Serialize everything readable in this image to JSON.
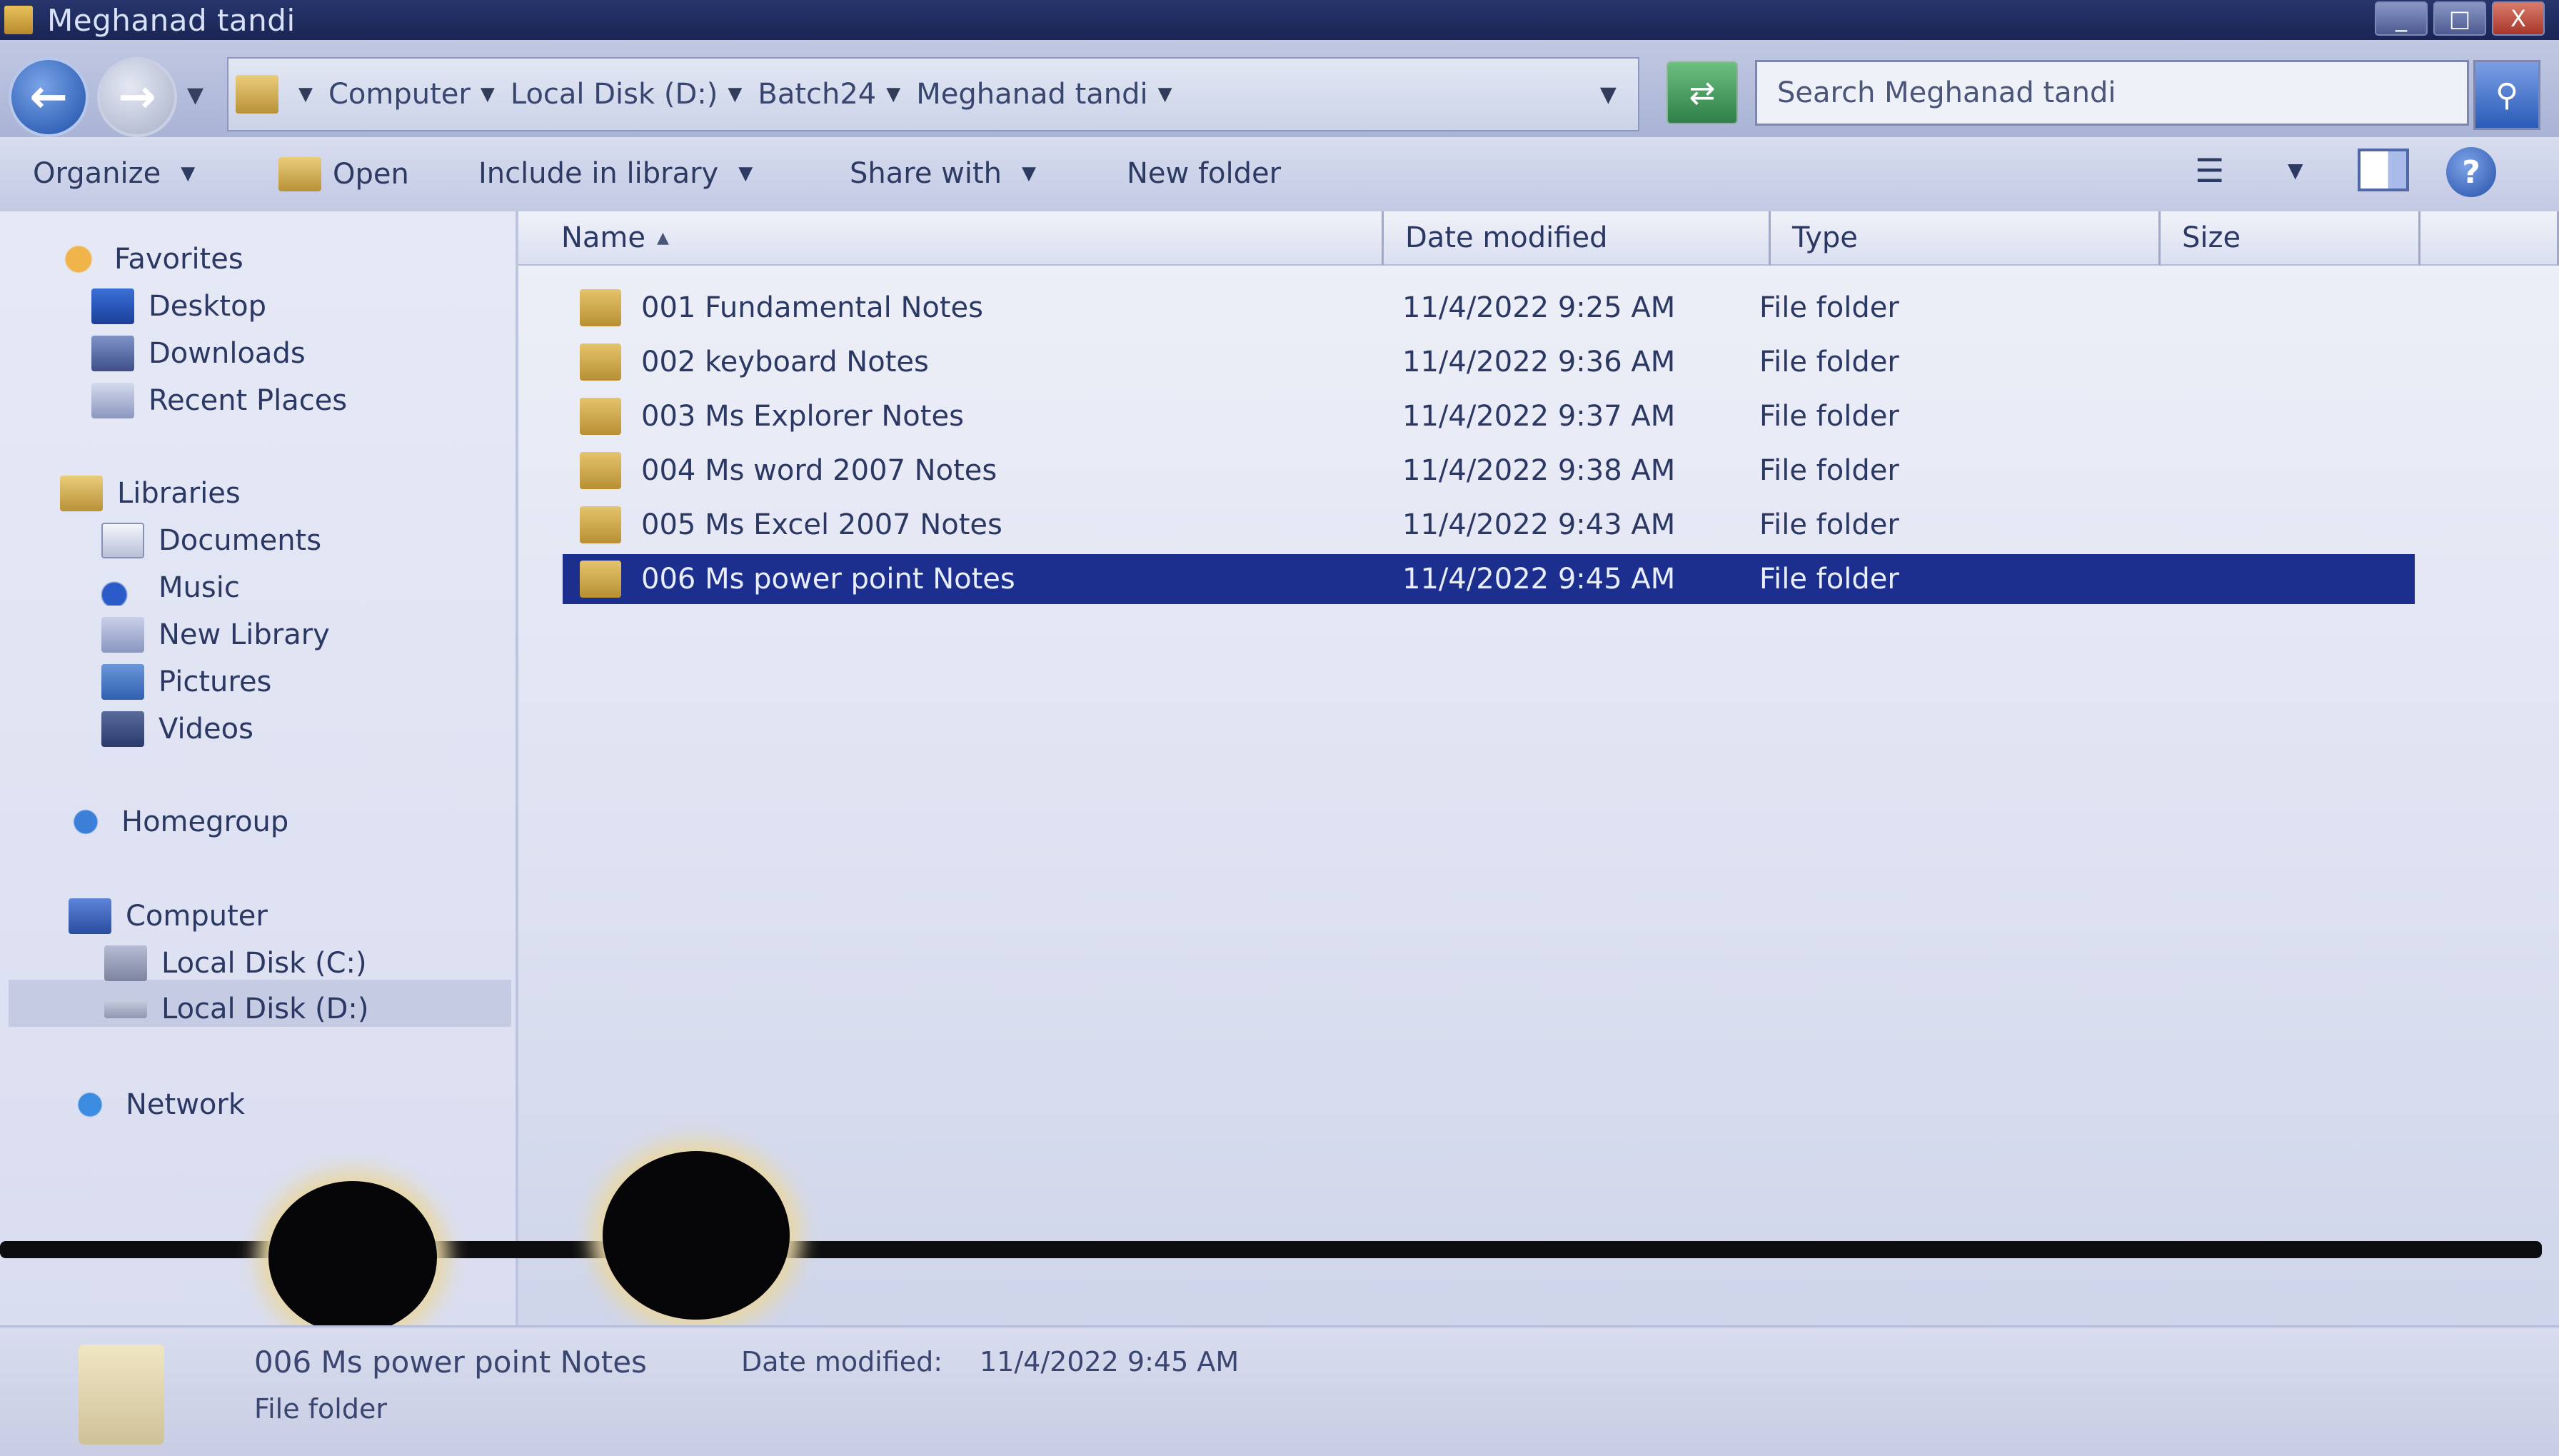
{
  "window": {
    "title": "Meghanad tandi",
    "minimize": "_",
    "maximize": "□",
    "close": "X"
  },
  "address": {
    "breadcrumbs": [
      "Computer",
      "Local Disk (D:)",
      "Batch24",
      "Meghanad tandi"
    ],
    "search_placeholder": "Search Meghanad tandi"
  },
  "toolbar": {
    "organize": "Organize",
    "open": "Open",
    "include_in_library": "Include in library",
    "share_with": "Share with",
    "new_folder": "New folder"
  },
  "nav": {
    "favorites": "Favorites",
    "desktop": "Desktop",
    "downloads": "Downloads",
    "recent_places": "Recent Places",
    "libraries": "Libraries",
    "documents": "Documents",
    "music": "Music",
    "new_library": "New Library",
    "pictures": "Pictures",
    "videos": "Videos",
    "homegroup": "Homegroup",
    "computer": "Computer",
    "local_disk_c": "Local Disk (C:)",
    "local_disk_d": "Local Disk (D:)",
    "network": "Network"
  },
  "columns": {
    "name": "Name",
    "date_modified": "Date modified",
    "type": "Type",
    "size": "Size"
  },
  "files": [
    {
      "name": "001 Fundamental Notes",
      "date": "11/4/2022 9:25 AM",
      "type": "File folder"
    },
    {
      "name": "002 keyboard Notes",
      "date": "11/4/2022 9:36 AM",
      "type": "File folder"
    },
    {
      "name": "003 Ms Explorer Notes",
      "date": "11/4/2022 9:37 AM",
      "type": "File folder"
    },
    {
      "name": "004 Ms word 2007 Notes",
      "date": "11/4/2022 9:38 AM",
      "type": "File folder"
    },
    {
      "name": "005 Ms Excel 2007 Notes",
      "date": "11/4/2022 9:43 AM",
      "type": "File folder"
    },
    {
      "name": "006 Ms power point Notes",
      "date": "11/4/2022 9:45 AM",
      "type": "File folder"
    }
  ],
  "selected_index": 5,
  "details": {
    "name": "006 Ms power point Notes",
    "date_label": "Date modified:",
    "date": "11/4/2022 9:45 AM",
    "type": "File folder"
  }
}
